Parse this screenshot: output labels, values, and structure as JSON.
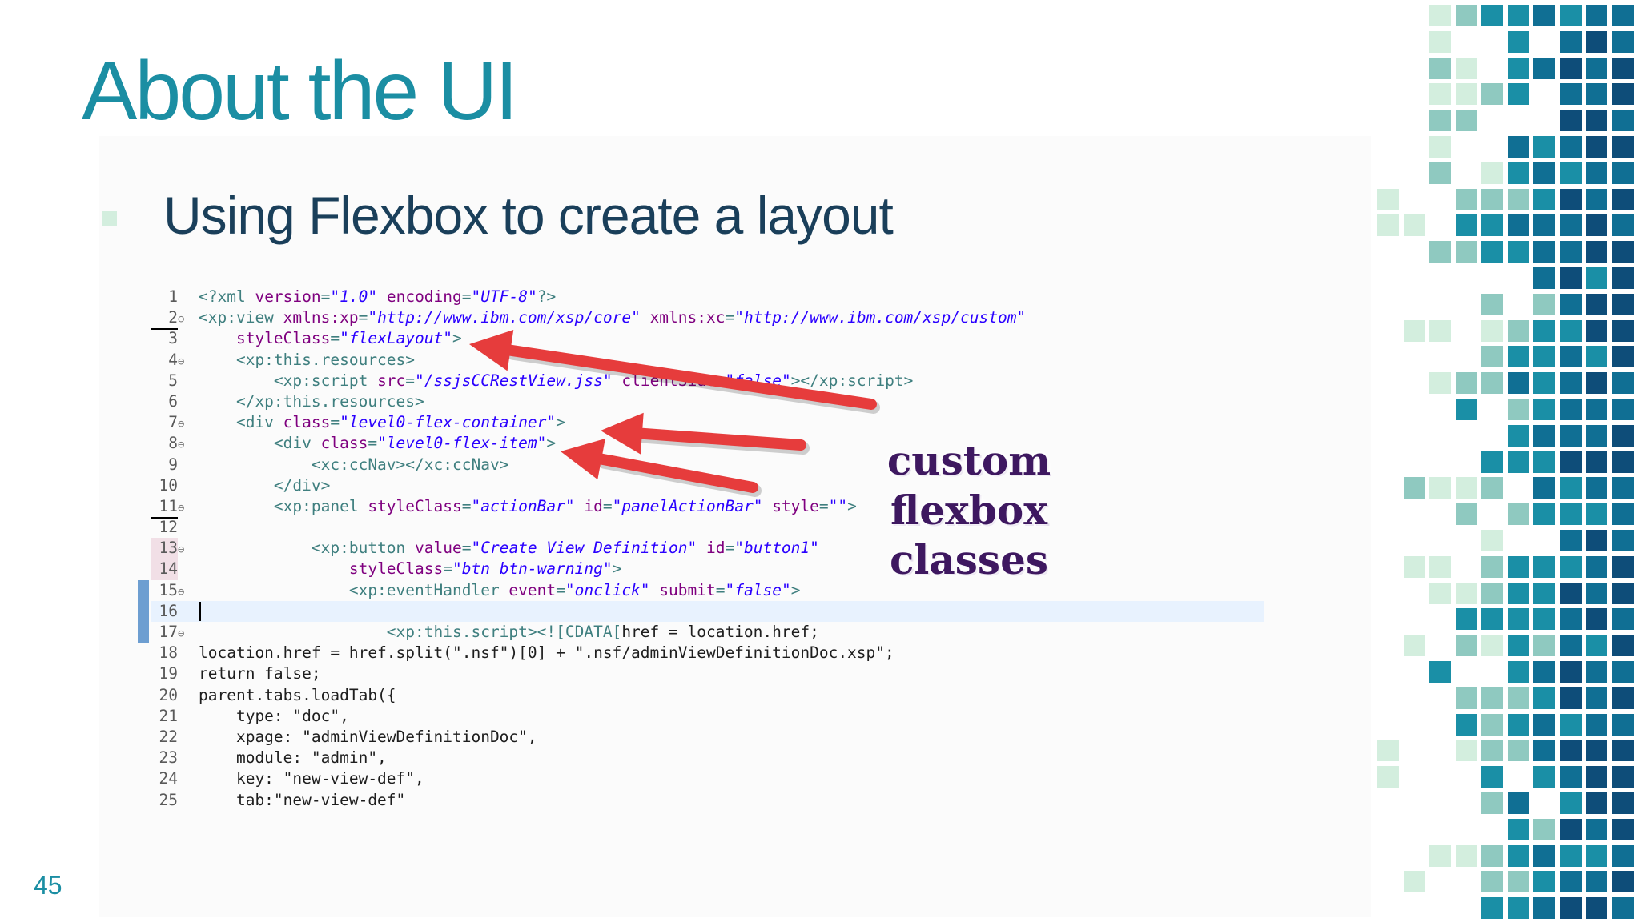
{
  "slide": {
    "title": "About the UI",
    "bullet": "Using Flexbox to create a layout",
    "page_number": "45",
    "annotation_lines": [
      "custom",
      "flexbox",
      "classes"
    ],
    "colors": {
      "title": "#1b8ea3",
      "bullet_text": "#1a3f5a",
      "arrow": "#e63c3c",
      "annotation": "#3e1860",
      "mosaic": [
        "#d3eede",
        "#8fc9c0",
        "#1a8fa6",
        "#106f94",
        "#0e4d79"
      ]
    }
  },
  "code_lines": [
    {
      "n": "1",
      "fold": "",
      "segs": [
        [
          "tag",
          "<?xml "
        ],
        [
          "attr",
          "version"
        ],
        [
          "tag",
          "="
        ],
        [
          "val",
          "\"1.0\""
        ],
        [
          "tag",
          " "
        ],
        [
          "attr",
          "encoding"
        ],
        [
          "tag",
          "="
        ],
        [
          "val",
          "\"UTF-8\""
        ],
        [
          "tag",
          "?>"
        ]
      ]
    },
    {
      "n": "2",
      "fold": "⊖",
      "mark": true,
      "segs": [
        [
          "tag",
          "<xp:view "
        ],
        [
          "attr",
          "xmlns:xp"
        ],
        [
          "tag",
          "="
        ],
        [
          "val",
          "\"http://www.ibm.com/xsp/core\""
        ],
        [
          "tag",
          " "
        ],
        [
          "attr",
          "xmlns:xc"
        ],
        [
          "tag",
          "="
        ],
        [
          "val",
          "\"http://www.ibm.com/xsp/custom\""
        ]
      ]
    },
    {
      "n": "3",
      "fold": "",
      "segs": [
        [
          "tag",
          "    "
        ],
        [
          "attr",
          "styleClass"
        ],
        [
          "tag",
          "="
        ],
        [
          "val",
          "\"flexLayout\""
        ],
        [
          "tag",
          ">"
        ]
      ]
    },
    {
      "n": "4",
      "fold": "⊖",
      "segs": [
        [
          "tag",
          "    <xp:this.resources>"
        ]
      ]
    },
    {
      "n": "5",
      "fold": "",
      "segs": [
        [
          "tag",
          "        <xp:script "
        ],
        [
          "attr",
          "src"
        ],
        [
          "tag",
          "="
        ],
        [
          "val",
          "\"/ssjsCCRestView.jss\""
        ],
        [
          "tag",
          " "
        ],
        [
          "attr",
          "clientSide"
        ],
        [
          "tag",
          "="
        ],
        [
          "val",
          "\"false\""
        ],
        [
          "tag",
          "></xp:script>"
        ]
      ]
    },
    {
      "n": "6",
      "fold": "",
      "segs": [
        [
          "tag",
          "    </xp:this.resources>"
        ]
      ]
    },
    {
      "n": "7",
      "fold": "⊖",
      "segs": [
        [
          "tag",
          "    <div "
        ],
        [
          "attr",
          "class"
        ],
        [
          "tag",
          "="
        ],
        [
          "val",
          "\"level0-flex-container\""
        ],
        [
          "tag",
          ">"
        ]
      ]
    },
    {
      "n": "8",
      "fold": "⊖",
      "segs": [
        [
          "tag",
          "        <div "
        ],
        [
          "attr",
          "class"
        ],
        [
          "tag",
          "="
        ],
        [
          "val",
          "\"level0-flex-item\""
        ],
        [
          "tag",
          ">"
        ]
      ]
    },
    {
      "n": "9",
      "fold": "",
      "segs": [
        [
          "tag",
          "            <xc:ccNav></xc:ccNav>"
        ]
      ]
    },
    {
      "n": "10",
      "fold": "",
      "segs": [
        [
          "tag",
          "        </div>"
        ]
      ]
    },
    {
      "n": "11",
      "fold": "⊖",
      "mark": true,
      "segs": [
        [
          "tag",
          "        <xp:panel "
        ],
        [
          "attr",
          "styleClass"
        ],
        [
          "tag",
          "="
        ],
        [
          "val",
          "\"actionBar\""
        ],
        [
          "tag",
          " "
        ],
        [
          "attr",
          "id"
        ],
        [
          "tag",
          "="
        ],
        [
          "val",
          "\"panelActionBar\""
        ],
        [
          "tag",
          " "
        ],
        [
          "attr",
          "style"
        ],
        [
          "tag",
          "="
        ],
        [
          "val",
          "\"\""
        ],
        [
          "tag",
          ">"
        ]
      ]
    },
    {
      "n": "12",
      "fold": "",
      "segs": []
    },
    {
      "n": "13",
      "fold": "⊖",
      "pink": true,
      "segs": [
        [
          "tag",
          "            <xp:button "
        ],
        [
          "attr",
          "value"
        ],
        [
          "tag",
          "="
        ],
        [
          "val",
          "\"Create View Definition\""
        ],
        [
          "tag",
          " "
        ],
        [
          "attr",
          "id"
        ],
        [
          "tag",
          "="
        ],
        [
          "val",
          "\"button1\""
        ]
      ]
    },
    {
      "n": "14",
      "fold": "",
      "pink": true,
      "segs": [
        [
          "tag",
          "                "
        ],
        [
          "attr",
          "styleClass"
        ],
        [
          "tag",
          "="
        ],
        [
          "val",
          "\"btn btn-warning\""
        ],
        [
          "tag",
          ">"
        ]
      ]
    },
    {
      "n": "15",
      "fold": "⊖",
      "bp": true,
      "segs": [
        [
          "tag",
          "                <xp:eventHandler "
        ],
        [
          "attr",
          "event"
        ],
        [
          "tag",
          "="
        ],
        [
          "val",
          "\"onclick\""
        ],
        [
          "tag",
          " "
        ],
        [
          "attr",
          "submit"
        ],
        [
          "tag",
          "="
        ],
        [
          "val",
          "\"false\""
        ],
        [
          "tag",
          ">"
        ]
      ]
    },
    {
      "n": "16",
      "fold": "",
      "bp": true,
      "current": true,
      "caret": true,
      "segs": []
    },
    {
      "n": "17",
      "fold": "⊖",
      "bp": true,
      "segs": [
        [
          "tag",
          "                    <xp:this.script><![CDATA["
        ],
        [
          "js",
          "href = location.href;"
        ]
      ]
    },
    {
      "n": "18",
      "fold": "",
      "segs": [
        [
          "js",
          "location.href = href.split(\".nsf\")[0] + \".nsf/adminViewDefinitionDoc.xsp\";"
        ]
      ]
    },
    {
      "n": "19",
      "fold": "",
      "segs": [
        [
          "js",
          "return false;"
        ]
      ]
    },
    {
      "n": "20",
      "fold": "",
      "segs": [
        [
          "js",
          "parent.tabs.loadTab({"
        ]
      ]
    },
    {
      "n": "21",
      "fold": "",
      "segs": [
        [
          "js",
          "    type: \"doc\","
        ]
      ]
    },
    {
      "n": "22",
      "fold": "",
      "segs": [
        [
          "js",
          "    xpage: \"adminViewDefinitionDoc\","
        ]
      ]
    },
    {
      "n": "23",
      "fold": "",
      "segs": [
        [
          "js",
          "    module: \"admin\","
        ]
      ]
    },
    {
      "n": "24",
      "fold": "",
      "segs": [
        [
          "js",
          "    key: \"new-view-def\","
        ]
      ]
    },
    {
      "n": "25",
      "fold": "",
      "segs": [
        [
          "js",
          "    tab:\"new-view-def\""
        ]
      ]
    }
  ]
}
